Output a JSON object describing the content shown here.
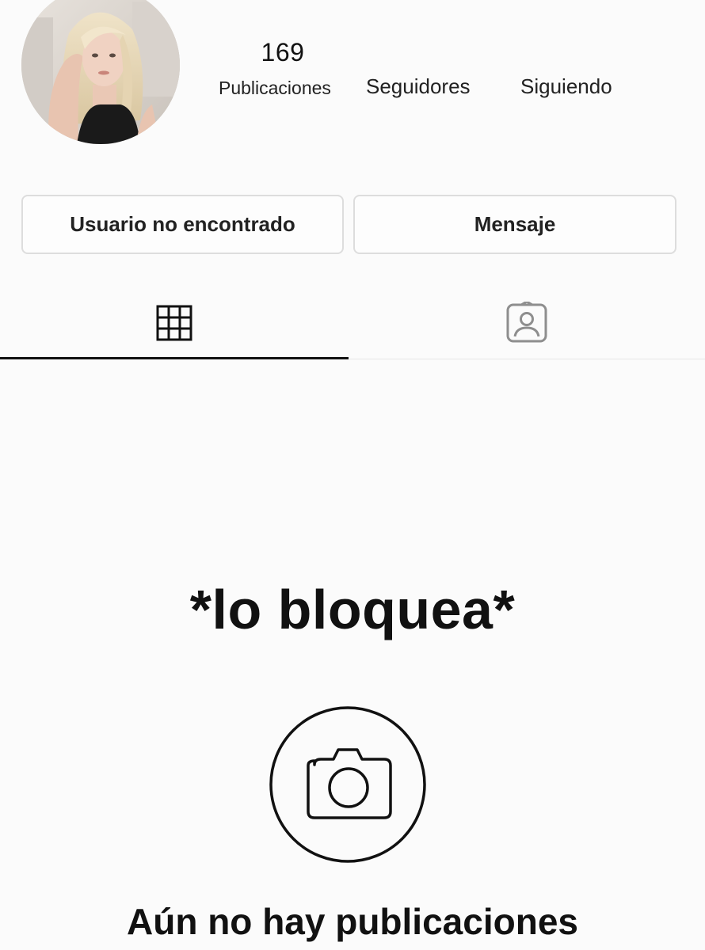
{
  "profile": {
    "avatar_icon": "profile-photo",
    "stats": {
      "posts_count": "169",
      "posts_label": "Publicaciones",
      "followers_label": "Seguidores",
      "following_label": "Siguiendo"
    }
  },
  "actions": {
    "user_status_label": "Usuario no encontrado",
    "message_label": "Mensaje"
  },
  "tabs": [
    {
      "icon": "grid-icon",
      "active": true
    },
    {
      "icon": "tagged-person-icon",
      "active": false
    }
  ],
  "meme_caption": "*lo bloquea*",
  "empty_state": {
    "icon": "camera-icon",
    "text": "Aún no hay publicaciones"
  },
  "colors": {
    "background": "#fbfbfb",
    "text": "#111111",
    "button_border": "#dddddd",
    "icon_gray": "#8e8e8e"
  }
}
